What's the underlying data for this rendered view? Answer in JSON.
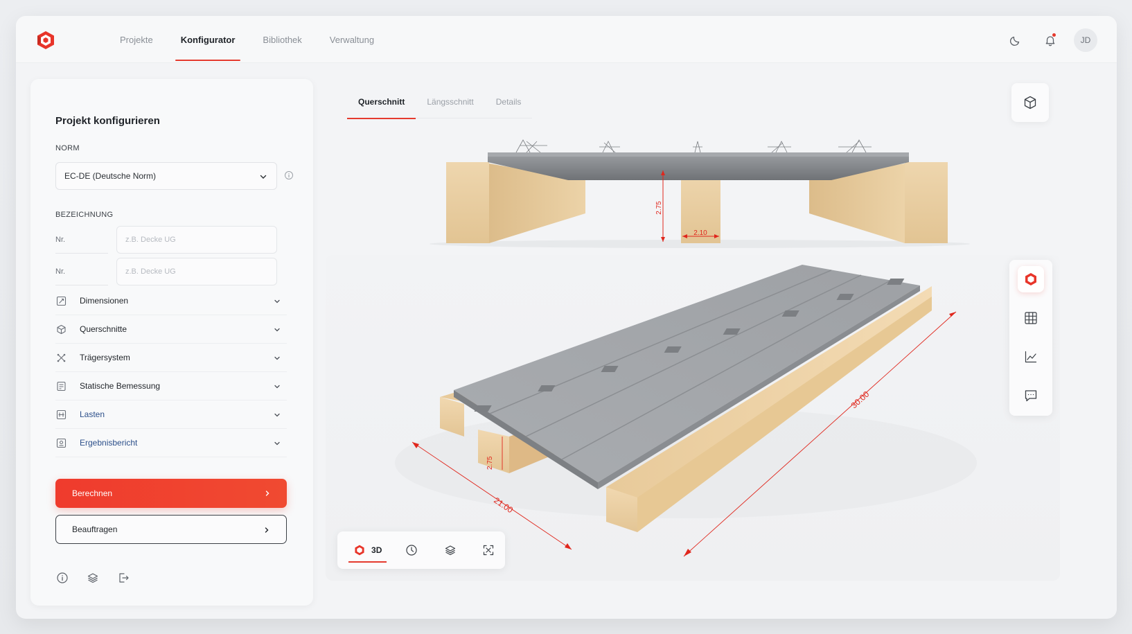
{
  "nav": {
    "items": [
      {
        "label": "Projekte",
        "active": false
      },
      {
        "label": "Konfigurator",
        "active": true
      },
      {
        "label": "Bibliothek",
        "active": false
      },
      {
        "label": "Verwaltung",
        "active": false
      }
    ],
    "avatar_initials": "JD",
    "icons": [
      "moon-icon",
      "bell-icon"
    ]
  },
  "panel": {
    "title": "Projekt konfigurieren",
    "norm_label": "NORM",
    "norm_value": "EC-DE (Deutsche Norm)",
    "bezeichnung_label": "BEZEICHNUNG",
    "fields": [
      {
        "label": "Nr.",
        "placeholder": "z.B. Decke UG"
      },
      {
        "label": "Nr.",
        "placeholder": "z.B. Decke UG"
      }
    ],
    "sections": [
      {
        "label": "Dimensionen",
        "icon": "dimension-icon",
        "blue": false
      },
      {
        "label": "Querschnitte",
        "icon": "cube-icon",
        "blue": false
      },
      {
        "label": "Trägersystem",
        "icon": "support-system-icon",
        "blue": false
      },
      {
        "label": "Statische Bemessung",
        "icon": "calculation-icon",
        "blue": false
      },
      {
        "label": "Lasten",
        "icon": "load-icon",
        "blue": true
      },
      {
        "label": "Ergebnisbericht",
        "icon": "report-icon",
        "blue": true
      }
    ],
    "primary_button": "Berechnen",
    "secondary_button": "Beauftragen"
  },
  "view_tabs": [
    {
      "label": "Querschnitt",
      "active": true
    },
    {
      "label": "Längsschnitt",
      "active": false
    },
    {
      "label": "Details",
      "active": false
    }
  ],
  "section_view": {
    "height_dim": "2.75",
    "width_dim": "2.10"
  },
  "model_view": {
    "dim_height": "2.75",
    "dim_width": "21.00",
    "dim_length": "30.00"
  },
  "bottom_toolbar": {
    "mode_label": "3D",
    "tools": [
      "clock-icon",
      "layers-icon",
      "fit-view-icon"
    ]
  },
  "side_toolbar": {
    "tools": [
      "model-3d-icon",
      "grid-icon",
      "chart-icon",
      "comment-icon"
    ]
  },
  "colors": {
    "accent": "#e53a2e",
    "concrete": "#8c8f93",
    "timber": "#e9cfa6",
    "dimension": "#e0261c"
  }
}
